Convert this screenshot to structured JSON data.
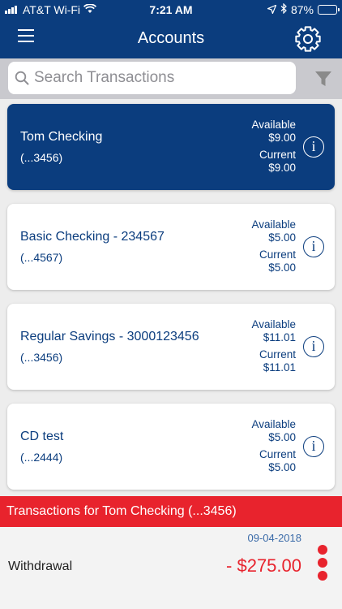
{
  "status_bar": {
    "carrier": "AT&T Wi-Fi",
    "time": "7:21 AM",
    "battery": "87%",
    "battery_level": 0.87
  },
  "nav": {
    "title": "Accounts",
    "menu_icon": "hamburger-menu-icon",
    "settings_icon": "gear-icon"
  },
  "search": {
    "placeholder": "Search Transactions",
    "value": "",
    "filter_icon": "filter-funnel-icon"
  },
  "accounts": [
    {
      "name": "Tom Checking",
      "number": "(...3456)",
      "available_label": "Available",
      "available": "$9.00",
      "current_label": "Current",
      "current": "$9.00",
      "selected": true
    },
    {
      "name": "Basic Checking - 234567",
      "number": "(...4567)",
      "available_label": "Available",
      "available": "$5.00",
      "current_label": "Current",
      "current": "$5.00",
      "selected": false
    },
    {
      "name": "Regular Savings - 3000123456",
      "number": "(...3456)",
      "available_label": "Available",
      "available": "$11.01",
      "current_label": "Current",
      "current": "$11.01",
      "selected": false
    },
    {
      "name": "CD test",
      "number": "(...2444)",
      "available_label": "Available",
      "available": "$5.00",
      "current_label": "Current",
      "current": "$5.00",
      "selected": false
    }
  ],
  "transactions": {
    "header": "Transactions for Tom Checking (...3456)",
    "items": [
      {
        "date": "09-04-2018",
        "description": "Withdrawal",
        "amount": "- $275.00"
      }
    ]
  },
  "colors": {
    "brand_blue": "#0b3d7e",
    "alert_red": "#e8232d"
  }
}
